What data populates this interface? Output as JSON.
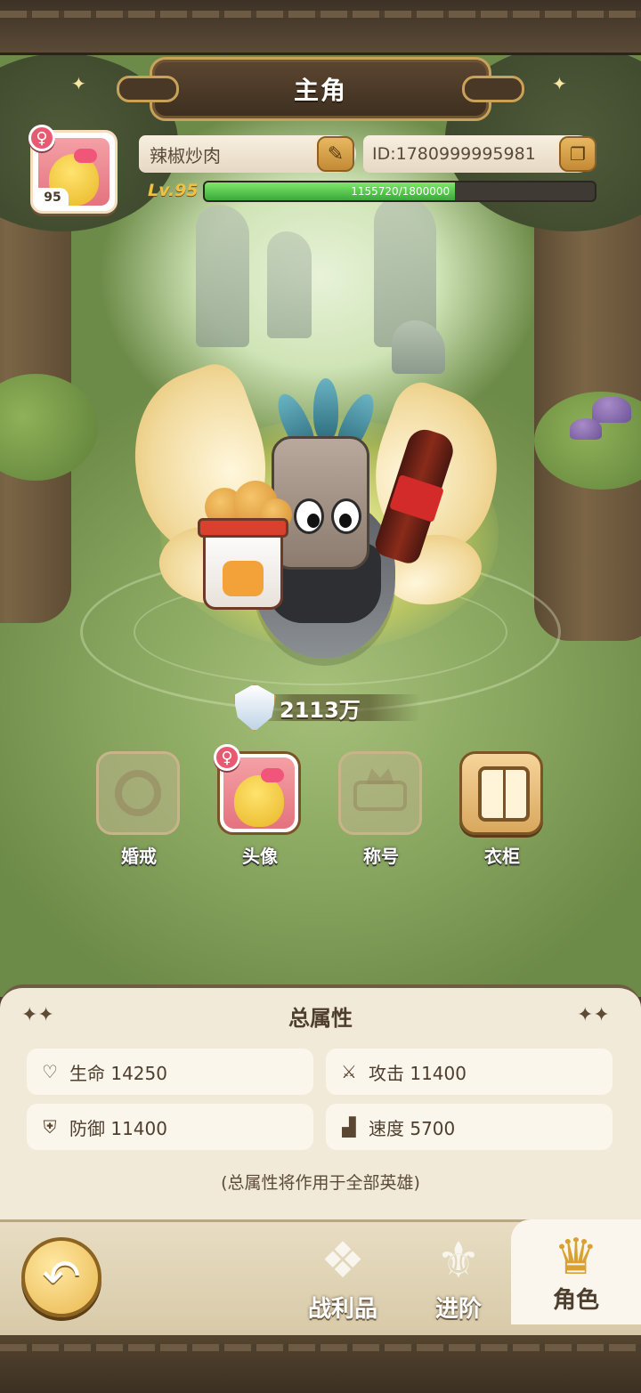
{
  "header": {
    "title": "主角"
  },
  "profile": {
    "avatar_level": "95",
    "name": "辣椒炒肉",
    "id_text": "ID:1780999995981",
    "level_label": "Lv.95",
    "xp_text": "1155720/1800000",
    "xp_fraction": 0.642
  },
  "power": {
    "value": "2113万"
  },
  "features": [
    {
      "label": "婚戒",
      "icon": "ring-icon",
      "active": false
    },
    {
      "label": "头像",
      "icon": "avatar-icon",
      "active": true
    },
    {
      "label": "称号",
      "icon": "crown-icon",
      "active": false
    },
    {
      "label": "衣柜",
      "icon": "wardrobe-icon",
      "active": true
    }
  ],
  "stats": {
    "title": "总属性",
    "items": [
      {
        "label": "生命 14250",
        "icon": "heart-icon"
      },
      {
        "label": "攻击 11400",
        "icon": "sword-icon"
      },
      {
        "label": "防御 11400",
        "icon": "shield-icon"
      },
      {
        "label": "速度 5700",
        "icon": "boot-icon"
      }
    ],
    "note": "(总属性将作用于全部英雄)"
  },
  "nav": {
    "tabs": [
      {
        "label": "战利品",
        "icon": "loot-icon",
        "active": false
      },
      {
        "label": "进阶",
        "icon": "advance-icon",
        "active": false
      },
      {
        "label": "角色",
        "icon": "role-icon",
        "active": true
      }
    ]
  },
  "colors": {
    "accent_gold": "#c9a25a",
    "xp_green": "#3aa93a",
    "panel_bg": "#f2ead9"
  }
}
